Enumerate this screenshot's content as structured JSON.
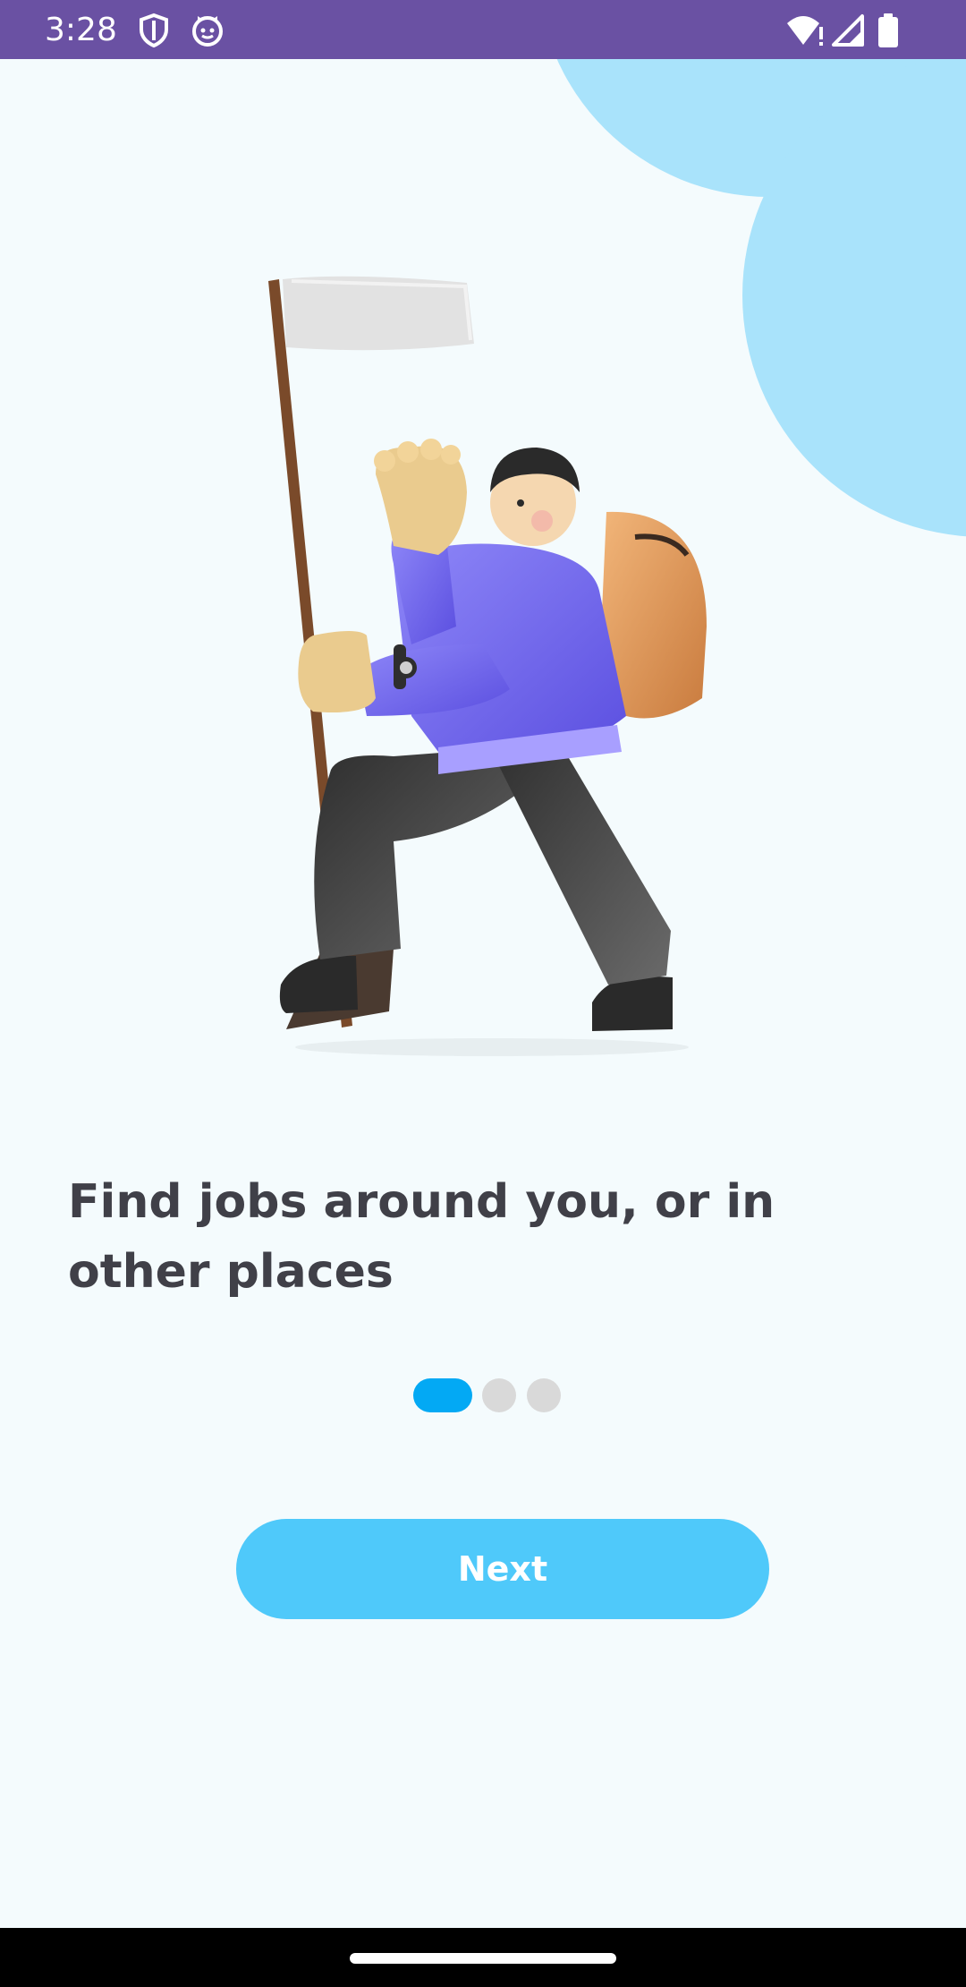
{
  "status_bar": {
    "time": "3:28",
    "icons": [
      "shield-icon",
      "cat-face-icon",
      "wifi-alert-icon",
      "cellular-signal-icon",
      "battery-icon"
    ]
  },
  "onboarding": {
    "illustration": "hiker-with-flag-illustration",
    "headline": "Find jobs around you, or in other places",
    "page_indicator": {
      "total": 3,
      "active_index": 0
    },
    "next_label": "Next"
  },
  "colors": {
    "status_bar": "#6A51A3",
    "background": "#F4FBFD",
    "accent_circle": "#A9E3FB",
    "dot_active": "#03A9F4",
    "dot_inactive": "#D9D9D9",
    "button": "#4FC9FA",
    "headline_text": "#404048",
    "nav_bar": "#000000"
  }
}
